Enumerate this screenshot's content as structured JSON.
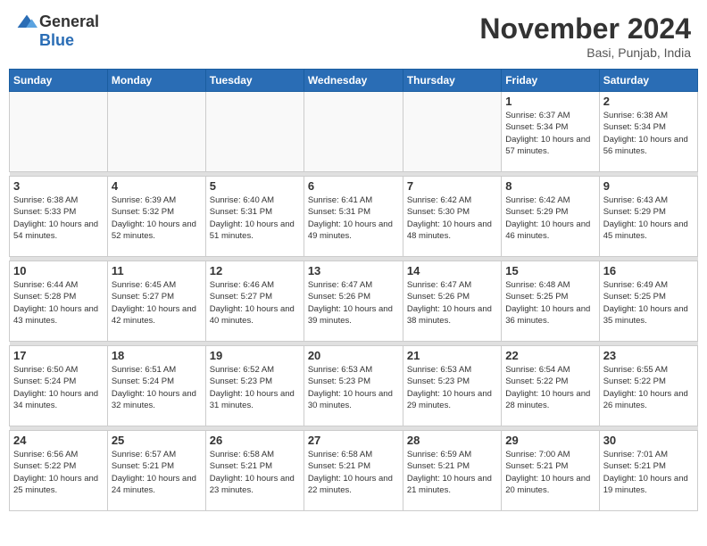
{
  "header": {
    "logo_general": "General",
    "logo_blue": "Blue",
    "month_title": "November 2024",
    "location": "Basi, Punjab, India"
  },
  "calendar": {
    "days_of_week": [
      "Sunday",
      "Monday",
      "Tuesday",
      "Wednesday",
      "Thursday",
      "Friday",
      "Saturday"
    ],
    "weeks": [
      [
        {
          "day": "",
          "info": ""
        },
        {
          "day": "",
          "info": ""
        },
        {
          "day": "",
          "info": ""
        },
        {
          "day": "",
          "info": ""
        },
        {
          "day": "",
          "info": ""
        },
        {
          "day": "1",
          "info": "Sunrise: 6:37 AM\nSunset: 5:34 PM\nDaylight: 10 hours and 57 minutes."
        },
        {
          "day": "2",
          "info": "Sunrise: 6:38 AM\nSunset: 5:34 PM\nDaylight: 10 hours and 56 minutes."
        }
      ],
      [
        {
          "day": "3",
          "info": "Sunrise: 6:38 AM\nSunset: 5:33 PM\nDaylight: 10 hours and 54 minutes."
        },
        {
          "day": "4",
          "info": "Sunrise: 6:39 AM\nSunset: 5:32 PM\nDaylight: 10 hours and 52 minutes."
        },
        {
          "day": "5",
          "info": "Sunrise: 6:40 AM\nSunset: 5:31 PM\nDaylight: 10 hours and 51 minutes."
        },
        {
          "day": "6",
          "info": "Sunrise: 6:41 AM\nSunset: 5:31 PM\nDaylight: 10 hours and 49 minutes."
        },
        {
          "day": "7",
          "info": "Sunrise: 6:42 AM\nSunset: 5:30 PM\nDaylight: 10 hours and 48 minutes."
        },
        {
          "day": "8",
          "info": "Sunrise: 6:42 AM\nSunset: 5:29 PM\nDaylight: 10 hours and 46 minutes."
        },
        {
          "day": "9",
          "info": "Sunrise: 6:43 AM\nSunset: 5:29 PM\nDaylight: 10 hours and 45 minutes."
        }
      ],
      [
        {
          "day": "10",
          "info": "Sunrise: 6:44 AM\nSunset: 5:28 PM\nDaylight: 10 hours and 43 minutes."
        },
        {
          "day": "11",
          "info": "Sunrise: 6:45 AM\nSunset: 5:27 PM\nDaylight: 10 hours and 42 minutes."
        },
        {
          "day": "12",
          "info": "Sunrise: 6:46 AM\nSunset: 5:27 PM\nDaylight: 10 hours and 40 minutes."
        },
        {
          "day": "13",
          "info": "Sunrise: 6:47 AM\nSunset: 5:26 PM\nDaylight: 10 hours and 39 minutes."
        },
        {
          "day": "14",
          "info": "Sunrise: 6:47 AM\nSunset: 5:26 PM\nDaylight: 10 hours and 38 minutes."
        },
        {
          "day": "15",
          "info": "Sunrise: 6:48 AM\nSunset: 5:25 PM\nDaylight: 10 hours and 36 minutes."
        },
        {
          "day": "16",
          "info": "Sunrise: 6:49 AM\nSunset: 5:25 PM\nDaylight: 10 hours and 35 minutes."
        }
      ],
      [
        {
          "day": "17",
          "info": "Sunrise: 6:50 AM\nSunset: 5:24 PM\nDaylight: 10 hours and 34 minutes."
        },
        {
          "day": "18",
          "info": "Sunrise: 6:51 AM\nSunset: 5:24 PM\nDaylight: 10 hours and 32 minutes."
        },
        {
          "day": "19",
          "info": "Sunrise: 6:52 AM\nSunset: 5:23 PM\nDaylight: 10 hours and 31 minutes."
        },
        {
          "day": "20",
          "info": "Sunrise: 6:53 AM\nSunset: 5:23 PM\nDaylight: 10 hours and 30 minutes."
        },
        {
          "day": "21",
          "info": "Sunrise: 6:53 AM\nSunset: 5:23 PM\nDaylight: 10 hours and 29 minutes."
        },
        {
          "day": "22",
          "info": "Sunrise: 6:54 AM\nSunset: 5:22 PM\nDaylight: 10 hours and 28 minutes."
        },
        {
          "day": "23",
          "info": "Sunrise: 6:55 AM\nSunset: 5:22 PM\nDaylight: 10 hours and 26 minutes."
        }
      ],
      [
        {
          "day": "24",
          "info": "Sunrise: 6:56 AM\nSunset: 5:22 PM\nDaylight: 10 hours and 25 minutes."
        },
        {
          "day": "25",
          "info": "Sunrise: 6:57 AM\nSunset: 5:21 PM\nDaylight: 10 hours and 24 minutes."
        },
        {
          "day": "26",
          "info": "Sunrise: 6:58 AM\nSunset: 5:21 PM\nDaylight: 10 hours and 23 minutes."
        },
        {
          "day": "27",
          "info": "Sunrise: 6:58 AM\nSunset: 5:21 PM\nDaylight: 10 hours and 22 minutes."
        },
        {
          "day": "28",
          "info": "Sunrise: 6:59 AM\nSunset: 5:21 PM\nDaylight: 10 hours and 21 minutes."
        },
        {
          "day": "29",
          "info": "Sunrise: 7:00 AM\nSunset: 5:21 PM\nDaylight: 10 hours and 20 minutes."
        },
        {
          "day": "30",
          "info": "Sunrise: 7:01 AM\nSunset: 5:21 PM\nDaylight: 10 hours and 19 minutes."
        }
      ]
    ]
  }
}
